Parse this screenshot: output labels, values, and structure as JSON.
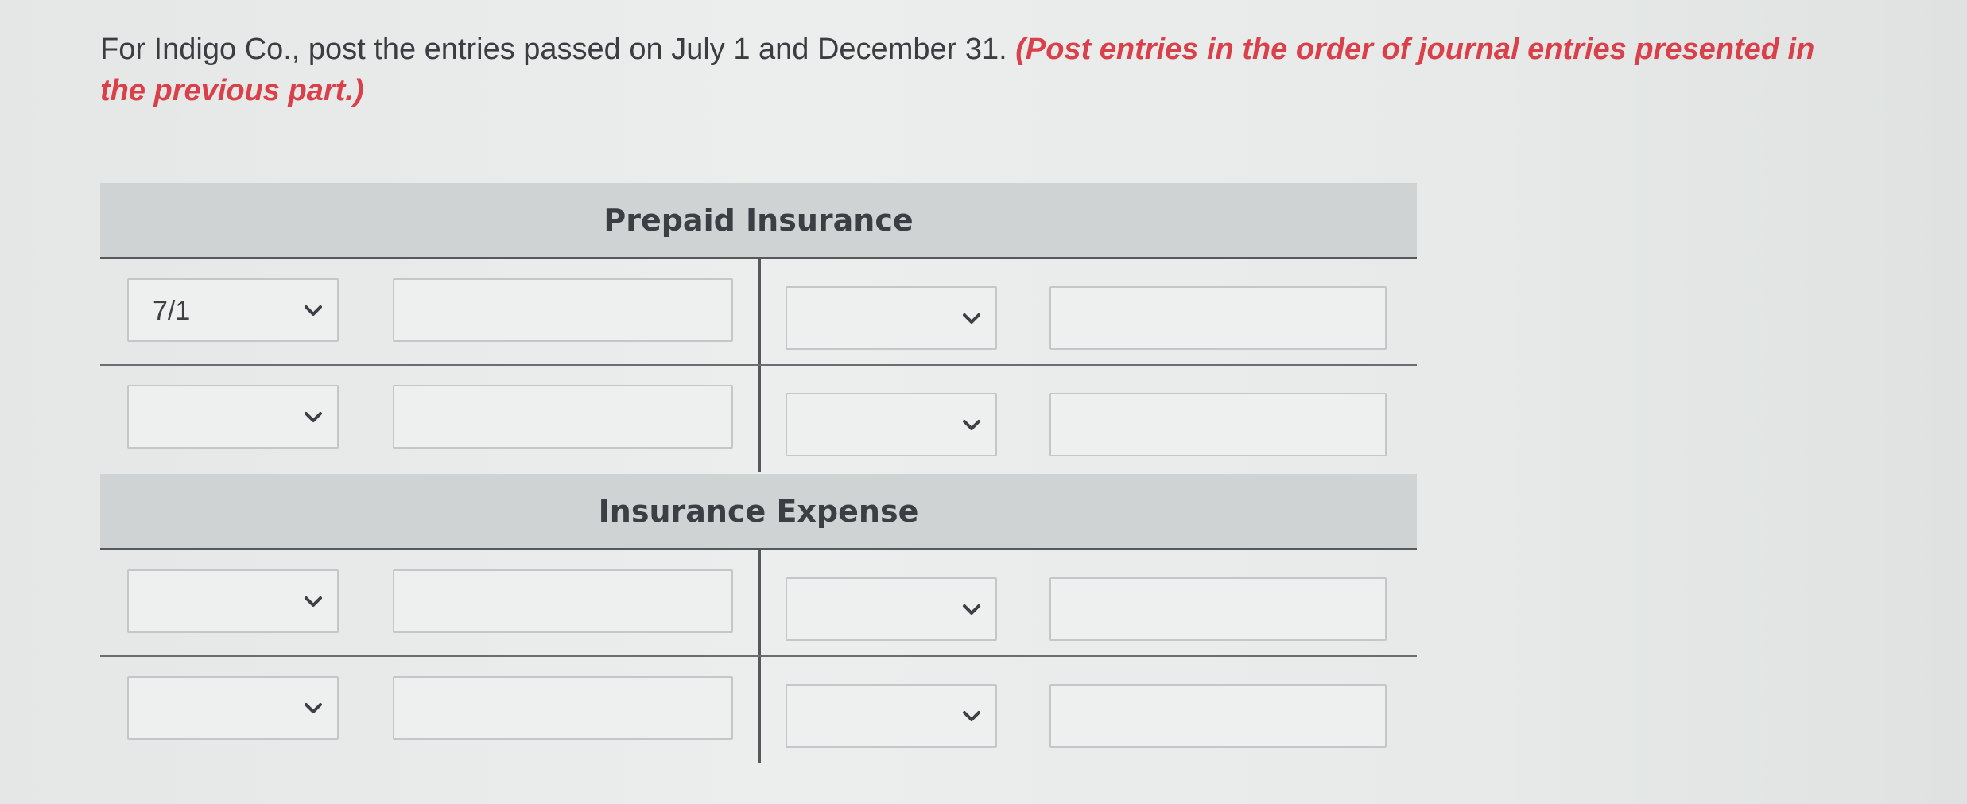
{
  "instruction": {
    "text": "For Indigo Co., post the entries passed on July 1 and December 31. ",
    "hint": "(Post entries in the order of journal entries presented in the previous part.)"
  },
  "accounts": [
    {
      "title": "Prepaid Insurance",
      "rows": [
        {
          "debit_date": "7/1",
          "debit_amount": "",
          "credit_date": "",
          "credit_amount": ""
        },
        {
          "debit_date": "",
          "debit_amount": "",
          "credit_date": "",
          "credit_amount": ""
        }
      ]
    },
    {
      "title": "Insurance Expense",
      "rows": [
        {
          "debit_date": "",
          "debit_amount": "",
          "credit_date": "",
          "credit_amount": ""
        },
        {
          "debit_date": "",
          "debit_amount": "",
          "credit_date": "",
          "credit_amount": ""
        }
      ]
    }
  ],
  "icons": {
    "dropdown": "chevron-down-icon"
  }
}
